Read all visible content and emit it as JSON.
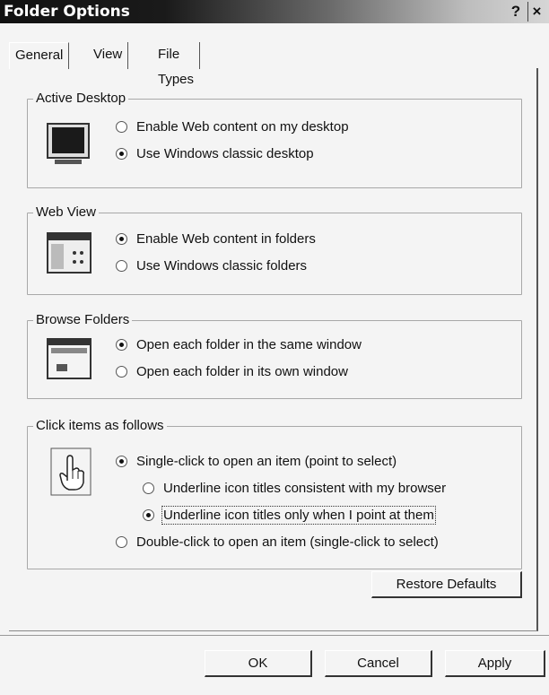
{
  "window": {
    "title": "Folder Options",
    "help_glyph": "?",
    "close_glyph": "×"
  },
  "tabs": [
    {
      "label": "General",
      "active": true
    },
    {
      "label": "View",
      "active": false
    },
    {
      "label": "File Types",
      "active": false
    }
  ],
  "groups": {
    "active_desktop": {
      "title": "Active Desktop",
      "icon": "monitor-icon",
      "options": [
        {
          "label": "Enable Web content on my desktop",
          "checked": false
        },
        {
          "label": "Use Windows classic desktop",
          "checked": true
        }
      ]
    },
    "web_view": {
      "title": "Web View",
      "icon": "web-folder-icon",
      "options": [
        {
          "label": "Enable Web content in folders",
          "checked": true
        },
        {
          "label": "Use Windows classic folders",
          "checked": false
        }
      ]
    },
    "browse_folders": {
      "title": "Browse Folders",
      "icon": "window-icon",
      "options": [
        {
          "label": "Open each folder in the same window",
          "checked": true
        },
        {
          "label": "Open each folder in its own window",
          "checked": false
        }
      ]
    },
    "click_items": {
      "title": "Click items as follows",
      "icon": "hand-pointer-icon",
      "options": [
        {
          "label": "Single-click to open an item (point to select)",
          "checked": true
        },
        {
          "label": "Underline icon titles consistent with my browser",
          "checked": false
        },
        {
          "label": "Underline icon titles only when I point at them",
          "checked": true
        },
        {
          "label": "Double-click to open an item (single-click to select)",
          "checked": false
        }
      ]
    }
  },
  "buttons": {
    "restore": "Restore Defaults",
    "ok": "OK",
    "cancel": "Cancel",
    "apply": "Apply"
  }
}
